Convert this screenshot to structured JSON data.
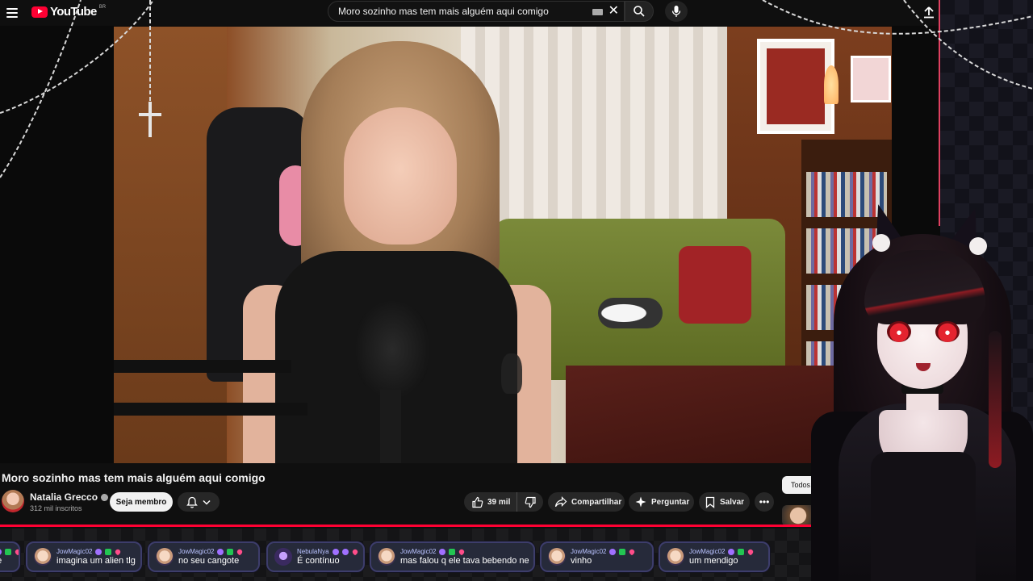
{
  "header": {
    "logo_text": "YouTube",
    "logo_country": "BR",
    "search_value": "Moro sozinho mas tem mais alguém aqui comigo",
    "clear_symbol": "✕"
  },
  "video": {
    "title": "Moro sozinho mas tem mais alguém aqui comigo",
    "progress": 1.0
  },
  "channel": {
    "name": "Natalia Grecco",
    "subscribers": "312 mil inscritos",
    "member_button": "Seja membro"
  },
  "actions": {
    "likes": "39 mil",
    "share": "Compartilhar",
    "ask": "Perguntar",
    "save": "Salvar",
    "more": "•••"
  },
  "sidebar": {
    "filter_all": "Todos"
  },
  "chat": [
    {
      "user": "",
      "text": "ne",
      "avatar": "pink"
    },
    {
      "user": "JowMagic02",
      "text": "imagina um alien tlg",
      "avatar": "pink"
    },
    {
      "user": "JowMagic02",
      "text": "no seu cangote",
      "avatar": "pink"
    },
    {
      "user": "NebulaNya",
      "text": "É contínuo",
      "avatar": "nebula"
    },
    {
      "user": "JowMagic02",
      "text": "mas falou q ele tava bebendo ne",
      "avatar": "pink"
    },
    {
      "user": "JowMagic02",
      "text": "vinho",
      "avatar": "pink"
    },
    {
      "user": "JowMagic02",
      "text": "um mendigo",
      "avatar": "pink"
    }
  ],
  "colors": {
    "brand_red": "#ff0033",
    "chat_bubble": "#262a3a",
    "chat_user": "#b9c2ff"
  },
  "icons": {
    "menu": "hamburger-menu-icon",
    "search": "search-icon",
    "mic": "microphone-icon",
    "upload": "upload-arrow-icon",
    "like": "thumbs-up-icon",
    "dislike": "thumbs-down-icon",
    "share": "share-arrow-icon",
    "ask": "sparkle-icon",
    "save": "bookmark-icon",
    "bell": "bell-icon"
  }
}
